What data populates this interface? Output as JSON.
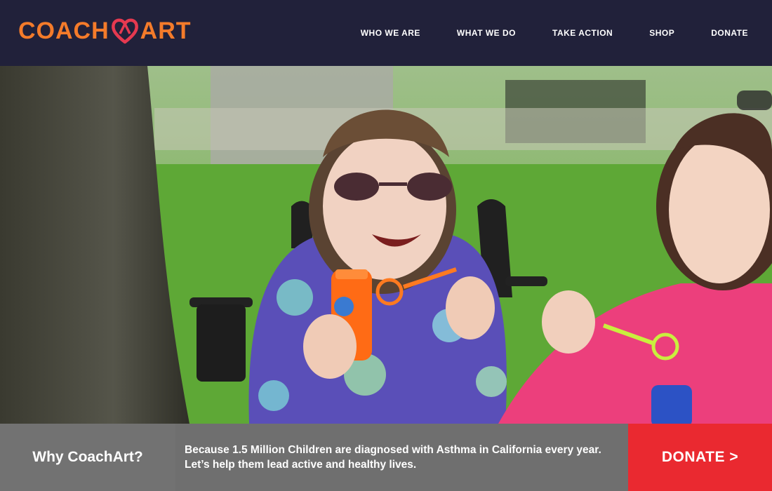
{
  "brand": {
    "name_left": "COACH",
    "name_right": "ART",
    "color": "#f47b2a"
  },
  "nav": {
    "items": [
      {
        "label": "WHO WE ARE"
      },
      {
        "label": "WHAT WE DO"
      },
      {
        "label": "TAKE ACTION"
      },
      {
        "label": "SHOP"
      },
      {
        "label": "DONATE"
      }
    ]
  },
  "hero": {
    "image": "photo-girl-blowing-bubbles-in-park"
  },
  "footer": {
    "why_label": "Why CoachArt?",
    "message": "Because 1.5 Million Children are diagnosed with Asthma in California every year. Let’s help them lead active and healthy lives.",
    "donate_label": "DONATE >",
    "donate_color": "#ea2930"
  },
  "colors": {
    "header_bg": "#21213a",
    "footer_gray": "#6f6f6f",
    "accent": "#f47b2a"
  }
}
